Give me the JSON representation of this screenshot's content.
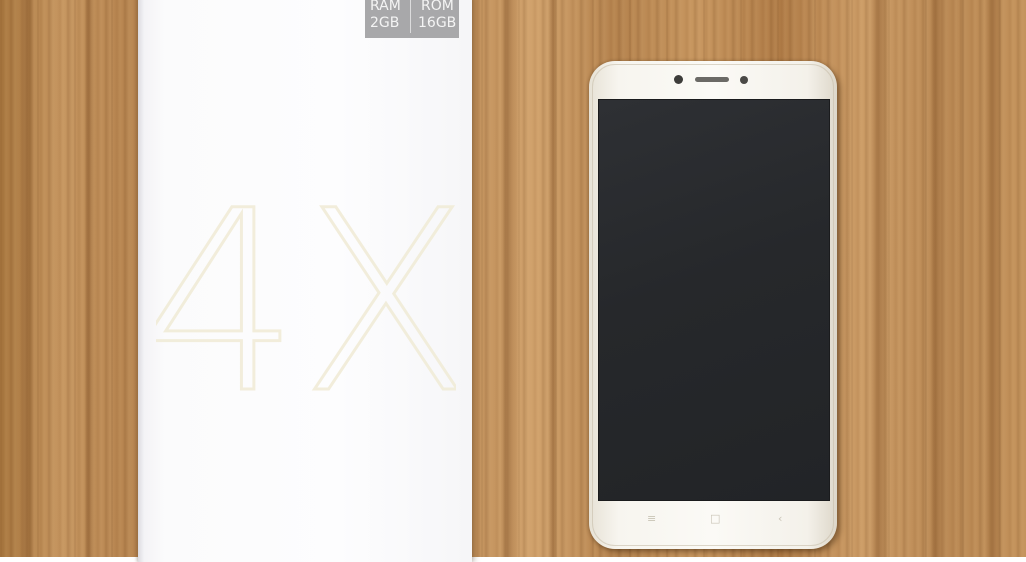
{
  "scene": "desk",
  "box": {
    "spec_badge": {
      "ram_label": "RAM",
      "ram_value": "2GB",
      "rom_label": "ROM",
      "rom_value": "16GB"
    },
    "model_mark": "4X"
  },
  "phone": {
    "color": "#f7f5ef",
    "screen_color": "#26282b",
    "nav_buttons": {
      "menu": "≡",
      "home": "□",
      "back": "‹"
    }
  },
  "colors": {
    "wood": "#b98a56",
    "box": "#fcfcfd",
    "badge": "#a8a8aa"
  }
}
